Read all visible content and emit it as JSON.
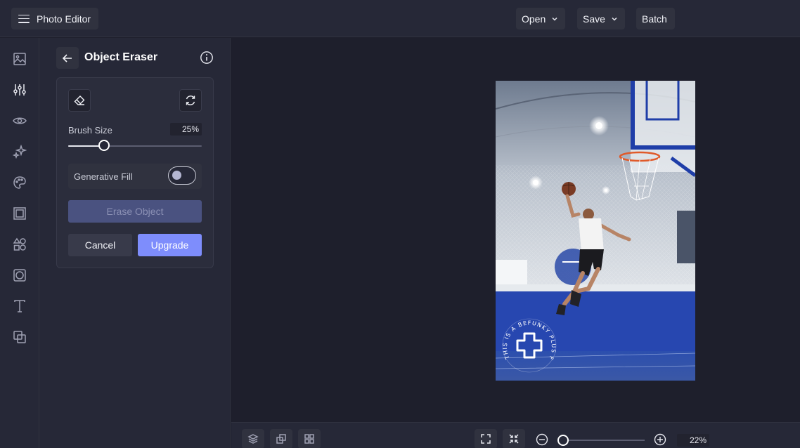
{
  "topbar": {
    "app_title": "Photo Editor",
    "open_label": "Open",
    "save_label": "Save",
    "batch_label": "Batch"
  },
  "rail": {
    "icons": [
      "image-icon",
      "adjustments-icon",
      "eye-icon",
      "sparkle-icon",
      "palette-icon",
      "frame-icon",
      "shapes-icon",
      "overlay-icon",
      "text-icon",
      "layers-blend-icon"
    ],
    "active": "adjustments-icon"
  },
  "panel": {
    "title": "Object Eraser",
    "brush_size_label": "Brush Size",
    "brush_size_value": "25%",
    "brush_size_fraction": 0.27,
    "generative_fill_label": "Generative Fill",
    "generative_fill_on": false,
    "erase_object_label": "Erase Object",
    "cancel_label": "Cancel",
    "upgrade_label": "Upgrade"
  },
  "watermark": {
    "text": "THIS IS A BEFUNKY PLUS FEATURE"
  },
  "bottombar": {
    "zoom_value": "22%"
  },
  "colors": {
    "accent": "#7e8dfc",
    "panel_bg": "#262837",
    "canvas_bg": "#1e1f2c"
  }
}
